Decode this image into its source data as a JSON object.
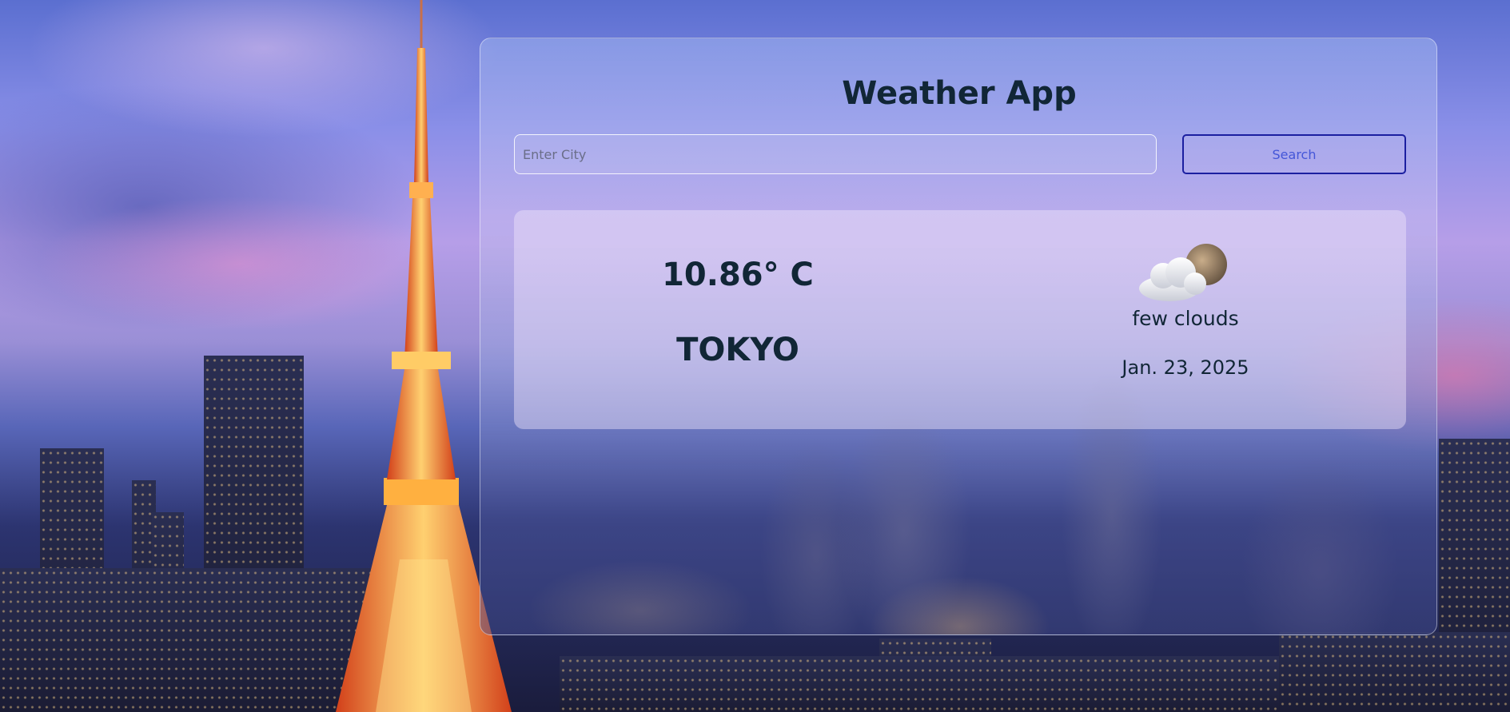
{
  "app": {
    "title": "Weather App"
  },
  "search": {
    "placeholder": "Enter City",
    "value": "",
    "button_label": "Search"
  },
  "weather": {
    "temperature": "10.86° C",
    "city": "TOKYO",
    "icon": "few-clouds-icon",
    "description": "few clouds",
    "date": "Jan. 23, 2025"
  },
  "colors": {
    "heading_text": "#112636",
    "button_border": "#1b1fa0",
    "button_text": "#4456d8"
  }
}
